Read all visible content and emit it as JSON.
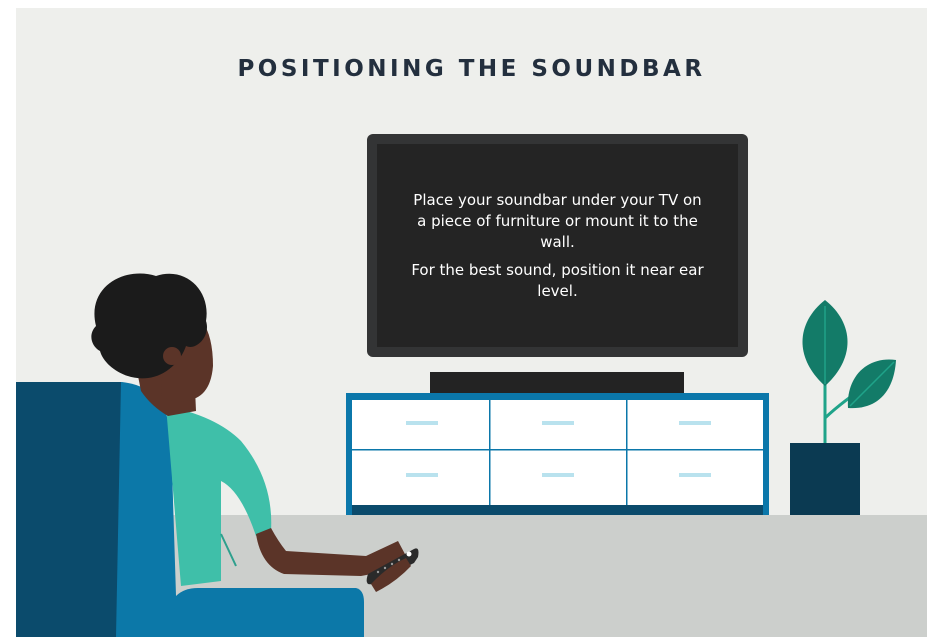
{
  "title": "POSITIONING THE SOUNDBAR",
  "tv": {
    "line1": "Place your soundbar under your TV on a piece of furniture or mount it to the wall.",
    "line2": "For the best sound, position it near ear level."
  },
  "colors": {
    "wall": "#eeefec",
    "floor": "#cccfcc",
    "tv_frame": "#333435",
    "tv_screen": "#242424",
    "soundbar": "#232323",
    "cabinet_frame": "#0b77aa",
    "cabinet_drawer": "#ffffff",
    "drawer_handle": "#b9e2ee",
    "chair_dark": "#0b4b6c",
    "chair_light": "#0c78a8",
    "shirt": "#3fbfa9",
    "skin": "#5b3428",
    "hair": "#1b1b1b",
    "pot": "#0b3a52",
    "leaf": "#137b68",
    "leaf_light": "#1fa389"
  },
  "icons": {
    "remote": "remote-control-icon",
    "plant": "plant-icon"
  }
}
